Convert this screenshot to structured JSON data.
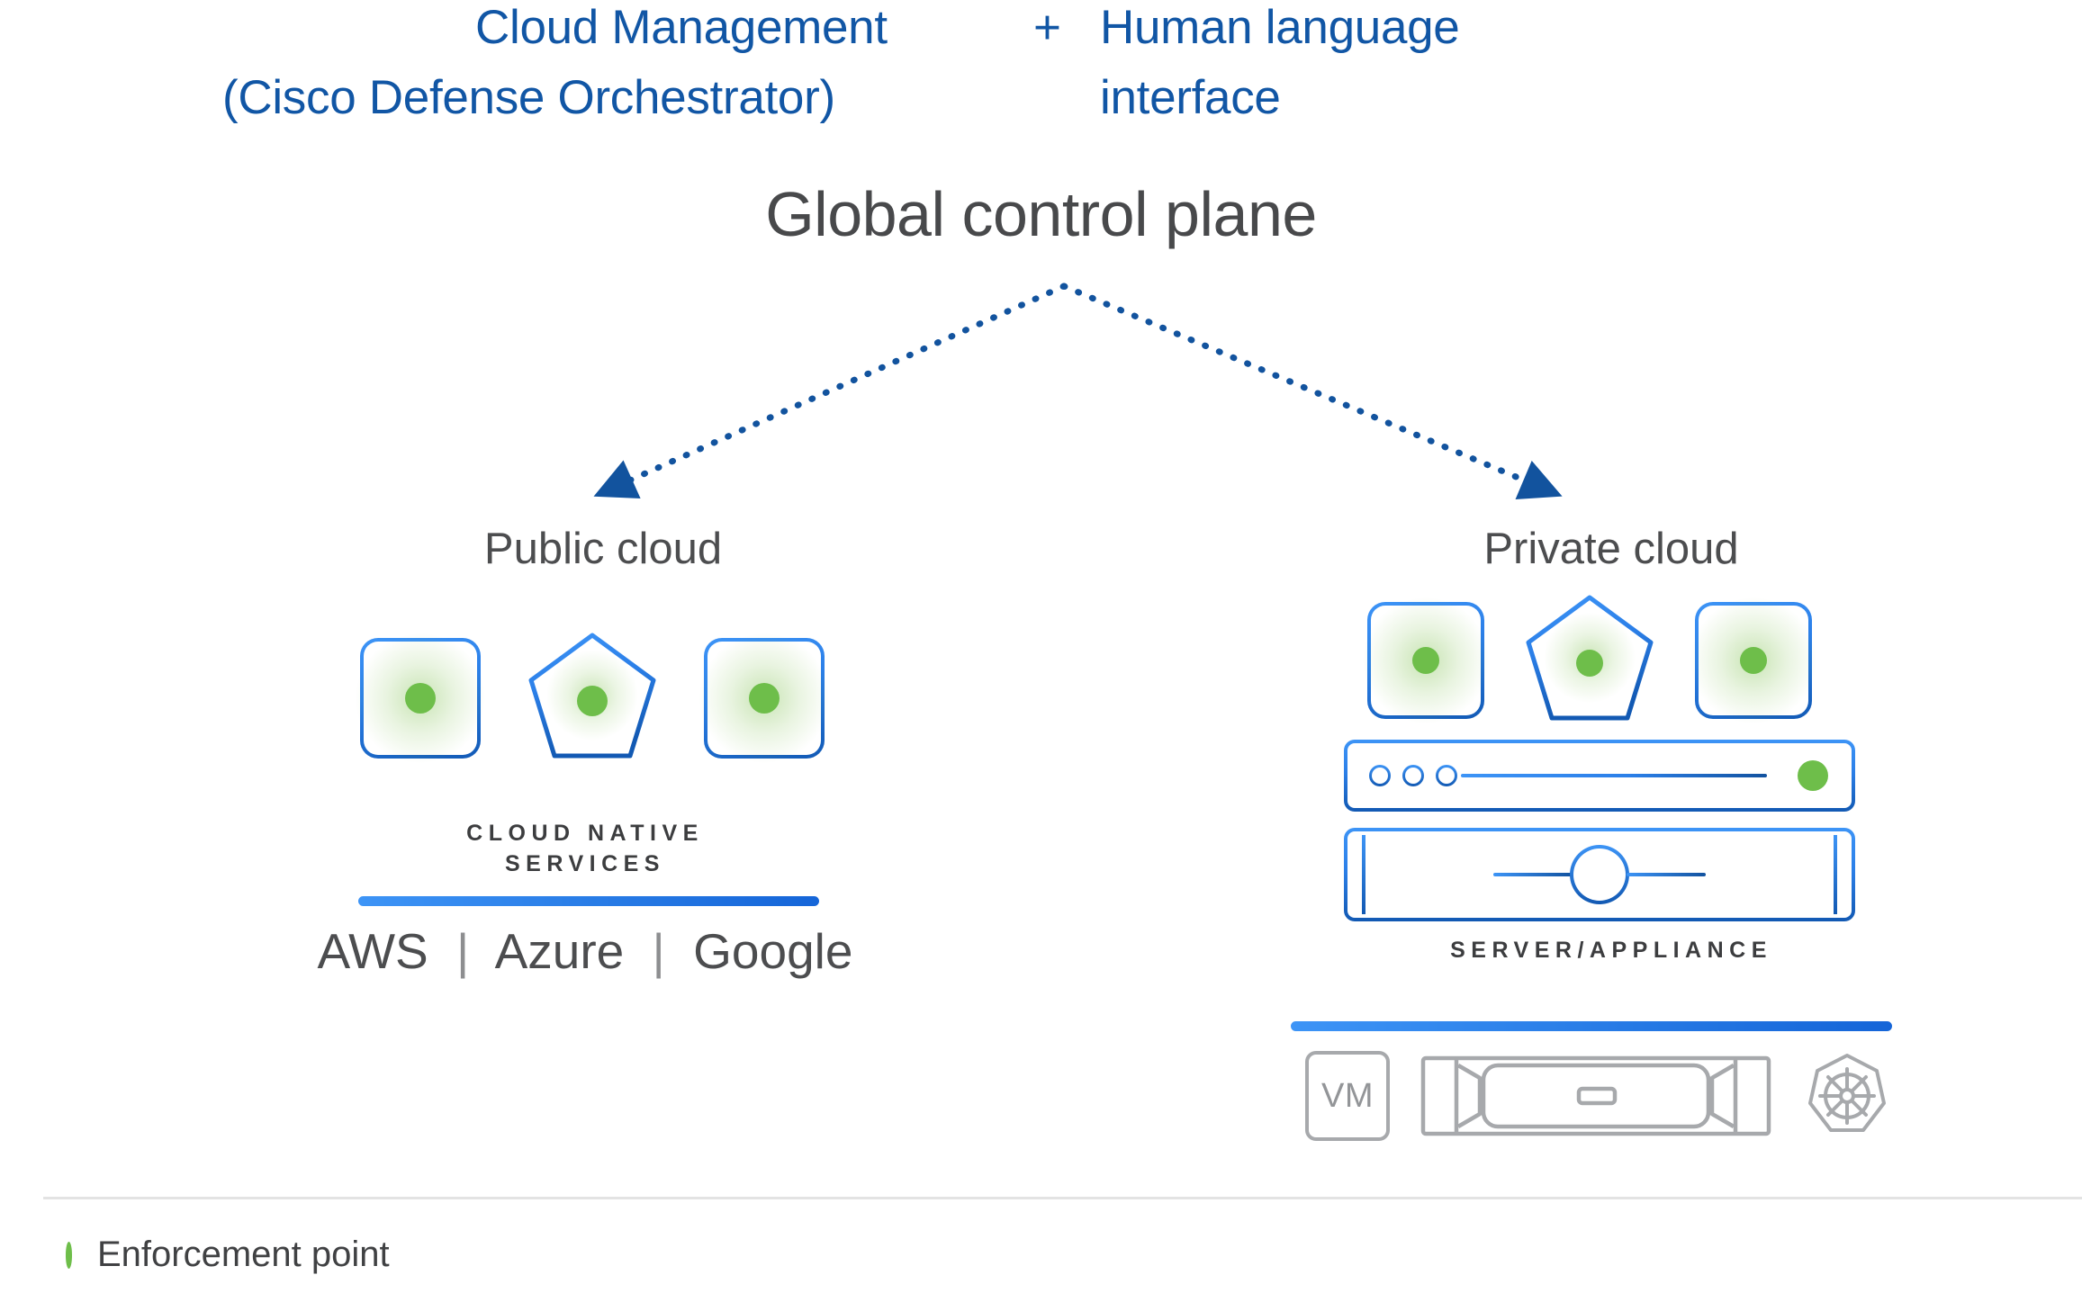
{
  "header": {
    "left_line1": "Cloud Management",
    "left_line2": "(Cisco Defense Orchestrator)",
    "plus": "+",
    "right_line1": "Human language",
    "right_line2": "interface",
    "color": "#1156a5"
  },
  "title": {
    "text": "Global control plane",
    "color": "#48494b"
  },
  "columns": {
    "public": {
      "label": "Public cloud",
      "caption_line1": "CLOUD NATIVE",
      "caption_line2": "SERVICES",
      "vendors": [
        "AWS",
        "Azure",
        "Google"
      ],
      "vendor_separator": "|",
      "nodes": [
        {
          "shape": "rounded-square",
          "enforcement": true
        },
        {
          "shape": "heptagon",
          "enforcement": true
        },
        {
          "shape": "rounded-square",
          "enforcement": true
        }
      ]
    },
    "private": {
      "label": "Private cloud",
      "caption": "SERVER/APPLIANCE",
      "nodes": [
        {
          "shape": "rounded-square",
          "enforcement": true
        },
        {
          "shape": "heptagon",
          "enforcement": true
        },
        {
          "shape": "rounded-square",
          "enforcement": true
        }
      ],
      "racks": [
        {
          "type": "rack-with-leds",
          "led_count": 3,
          "enforcement": true
        },
        {
          "type": "rack-with-dial",
          "enforcement": false
        }
      ],
      "platforms": [
        {
          "name": "vm-icon",
          "label": "VM"
        },
        {
          "name": "server-appliance-icon",
          "label": ""
        },
        {
          "name": "kubernetes-icon",
          "label": ""
        }
      ]
    }
  },
  "legend": {
    "label": "Enforcement point",
    "dot_color": "#6ebe4a"
  },
  "colors": {
    "brand_blue": "#1156a5",
    "accent_blue_light": "#3d94f6",
    "accent_blue_dark": "#1259b3",
    "enforcement_green": "#6ebe4a",
    "text_gray": "#4c4d4f",
    "icon_gray": "#a7a9ac",
    "rule_gray": "#e3e3e3"
  },
  "arrows": {
    "style": "dotted",
    "color": "#12539e",
    "count": 2,
    "origin_label": "Global control plane",
    "targets": [
      "Public cloud",
      "Private cloud"
    ]
  }
}
